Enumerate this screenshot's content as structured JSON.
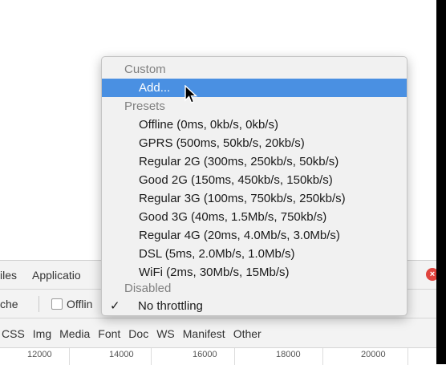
{
  "devtools": {
    "tabs": [
      {
        "label": "iles"
      },
      {
        "label": "Applicatio"
      }
    ],
    "close_icon": "×",
    "toolbar": {
      "cache_label": "che",
      "offline_label": "Offlin"
    },
    "filters": [
      "CSS",
      "Img",
      "Media",
      "Font",
      "Doc",
      "WS",
      "Manifest",
      "Other"
    ],
    "timeline_values": [
      "12000",
      "14000",
      "16000",
      "18000",
      "20000"
    ]
  },
  "menu": {
    "custom_header": "Custom",
    "add_label": "Add...",
    "presets_header": "Presets",
    "presets": [
      "Offline (0ms, 0kb/s, 0kb/s)",
      "GPRS (500ms, 50kb/s, 20kb/s)",
      "Regular 2G (300ms, 250kb/s, 50kb/s)",
      "Good 2G (150ms, 450kb/s, 150kb/s)",
      "Regular 3G (100ms, 750kb/s, 250kb/s)",
      "Good 3G (40ms, 1.5Mb/s, 750kb/s)",
      "Regular 4G (20ms, 4.0Mb/s, 3.0Mb/s)",
      "DSL (5ms, 2.0Mb/s, 1.0Mb/s)",
      "WiFi (2ms, 30Mb/s, 15Mb/s)"
    ],
    "disabled_header": "Disabled",
    "no_throttling_label": "No throttling",
    "checkmark": "✓"
  },
  "colors": {
    "selection": "#4a90e2",
    "close_button": "#e0443e"
  }
}
